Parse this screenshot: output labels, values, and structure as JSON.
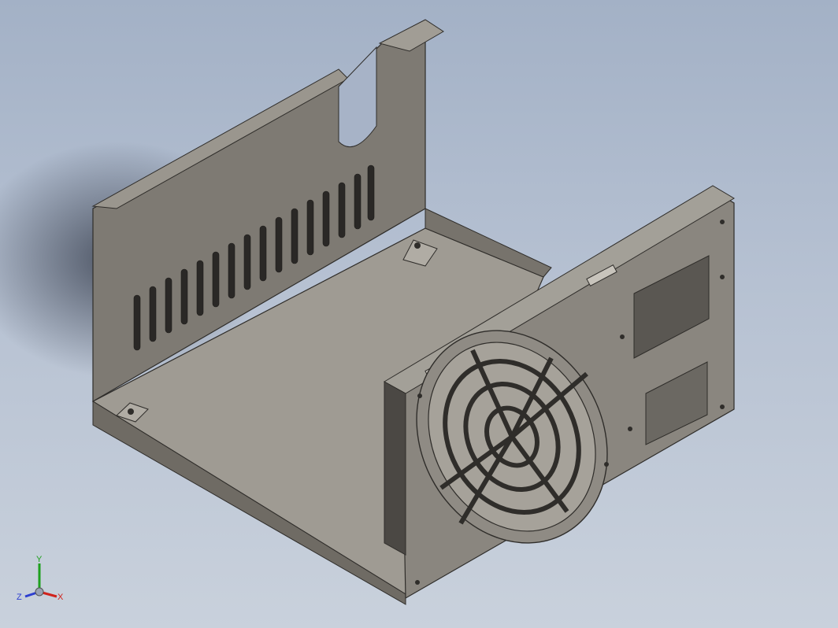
{
  "viewport": {
    "background_top": "#a3b1c6",
    "background_bottom": "#c9d1dc"
  },
  "model": {
    "part_color": "#9a958c",
    "edge_color": "#2f2d2a"
  },
  "triad": {
    "x_label": "X",
    "y_label": "Y",
    "z_label": "Z",
    "x_color": "#d0231d",
    "y_color": "#1da01d",
    "z_color": "#2d3fd0"
  }
}
